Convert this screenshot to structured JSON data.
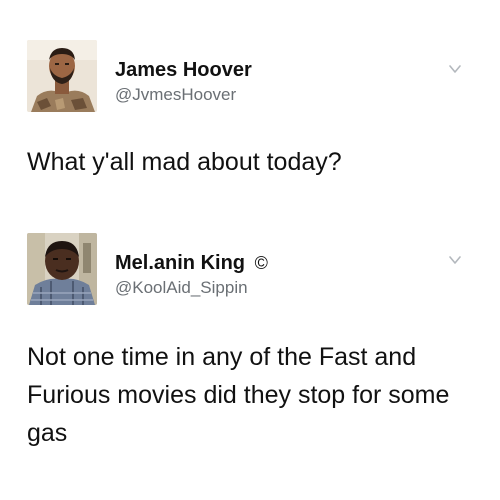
{
  "tweets": [
    {
      "author": {
        "name": "James Hoover",
        "handle": "@JvmesHoover",
        "verified_symbol": ""
      },
      "text": "What y'all mad about today?",
      "avatar_icon": "profile-photo-icon",
      "menu_icon": "chevron-down-icon"
    },
    {
      "author": {
        "name": "Mel.anin King",
        "handle": "@KoolAid_Sippin",
        "verified_symbol": "©"
      },
      "text": "Not one time in any of the Fast and Furious movies did they stop for some gas",
      "avatar_icon": "profile-photo-icon",
      "menu_icon": "chevron-down-icon"
    }
  ],
  "colors": {
    "background": "#ffffff",
    "text": "#111111",
    "handle": "#6a6f74",
    "chevron": "#b3b8bd"
  }
}
